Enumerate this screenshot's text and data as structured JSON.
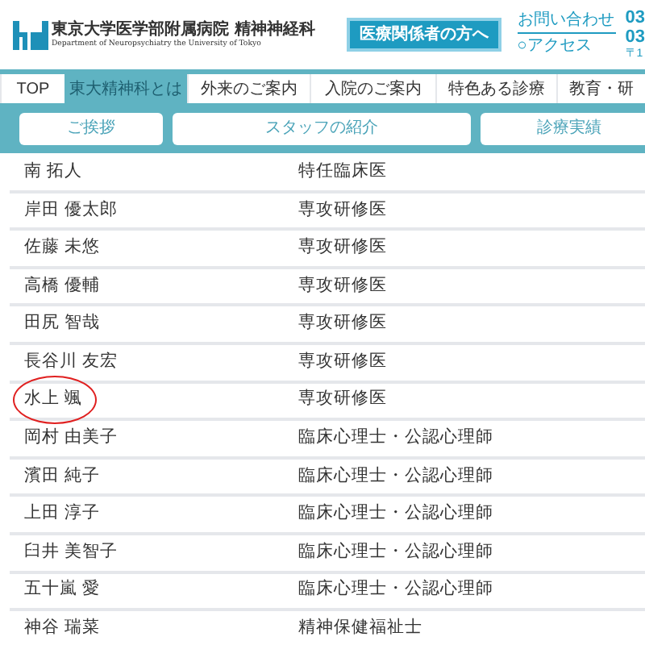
{
  "header": {
    "logo_title": "東京大学医学部附属病院 精神神経科",
    "logo_subtitle": "Department of Neuropsychiatry the University of Tokyo",
    "staff_button": "医療関係者の方へ",
    "contact_link": "お問い合わせ",
    "access_link": "○アクセス",
    "phone_1": "03",
    "phone_2": "03",
    "postal": "〒1"
  },
  "nav": {
    "tabs": [
      {
        "label": "TOP",
        "selected": false
      },
      {
        "label": "東大精神科とは",
        "selected": true
      },
      {
        "label": "外来のご案内",
        "selected": false
      },
      {
        "label": "入院のご案内",
        "selected": false
      },
      {
        "label": "特色ある診療",
        "selected": false
      },
      {
        "label": "教育・研",
        "selected": false
      }
    ]
  },
  "submenu": [
    "ご挨拶",
    "スタッフの紹介",
    "診療実績"
  ],
  "staff_rows": [
    {
      "name": "南 拓人",
      "role": "特任臨床医",
      "circled": false
    },
    {
      "name": "岸田 優太郎",
      "role": "専攻研修医",
      "circled": false
    },
    {
      "name": "佐藤 未悠",
      "role": "専攻研修医",
      "circled": false
    },
    {
      "name": "高橋 優輔",
      "role": "専攻研修医",
      "circled": false
    },
    {
      "name": "田尻 智哉",
      "role": "専攻研修医",
      "circled": false
    },
    {
      "name": "長谷川 友宏",
      "role": "専攻研修医",
      "circled": false
    },
    {
      "name": "水上 颯",
      "role": "専攻研修医",
      "circled": true
    },
    {
      "name": "岡村 由美子",
      "role": "臨床心理士・公認心理師",
      "circled": false
    },
    {
      "name": "濱田 純子",
      "role": "臨床心理士・公認心理師",
      "circled": false
    },
    {
      "name": "上田 淳子",
      "role": "臨床心理士・公認心理師",
      "circled": false
    },
    {
      "name": "臼井 美智子",
      "role": "臨床心理士・公認心理師",
      "circled": false
    },
    {
      "name": "五十嵐 愛",
      "role": "臨床心理士・公認心理師",
      "circled": false
    },
    {
      "name": "神谷 瑞菜",
      "role": "精神保健福祉士",
      "circled": false
    }
  ]
}
